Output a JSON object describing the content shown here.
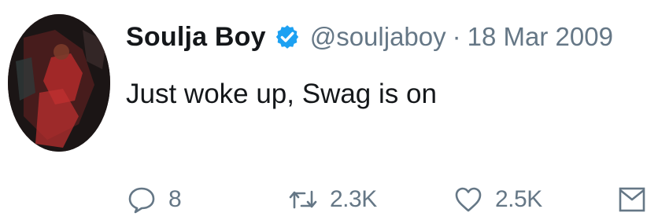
{
  "tweet": {
    "author_name": "Soulja Boy",
    "handle": "@souljaboy",
    "separator": "·",
    "date": "18 Mar 2009",
    "text": "Just woke up, Swag is on",
    "verified": true,
    "accent_color": "#1da1f2",
    "muted_color": "#657786"
  },
  "actions": {
    "reply": {
      "icon": "reply-icon",
      "count": "8"
    },
    "retweet": {
      "icon": "retweet-icon",
      "count": "2.3K"
    },
    "like": {
      "icon": "heart-icon",
      "count": "2.5K"
    },
    "dm": {
      "icon": "envelope-icon"
    }
  }
}
